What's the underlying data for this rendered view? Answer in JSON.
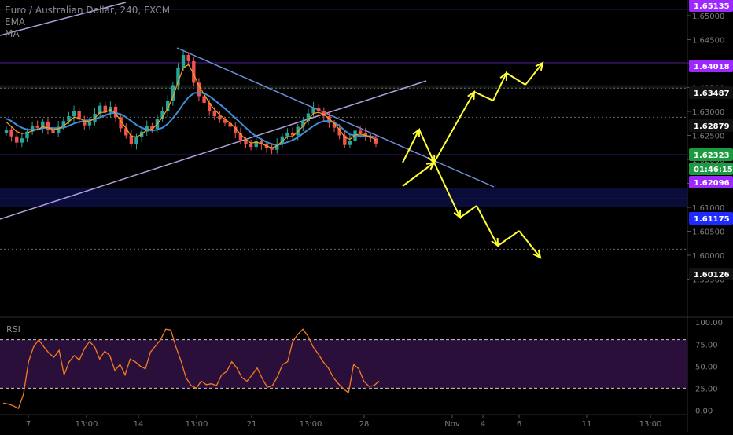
{
  "symbol_title": "Euro / Australian Dollar, 240, FXCM",
  "indicators": [
    "EMA",
    "MA"
  ],
  "colors": {
    "background": "#000000",
    "up_candle": "#26a69a",
    "down_candle": "#ef5350",
    "ema": "#f7a21b",
    "ma": "#3e8fd8",
    "trendline_down": "#6d8fdb",
    "channel_line": "#b39ddb",
    "projection_arrow": "#ffff33",
    "rsi_line": "#f57c21",
    "rsi_band": "#2a0f3a",
    "level_purple": "#9c27ff",
    "level_blue": "#1e2bff",
    "current_price": "#1b9a3f"
  },
  "chart_data": [
    {
      "type": "candlestick",
      "name": "price",
      "ylim": [
        1.5925,
        1.6535
      ],
      "y_ticks": [
        "1.65000",
        "1.64500",
        "1.64000",
        "1.63500",
        "1.63000",
        "1.62500",
        "1.62000",
        "1.61500",
        "1.61000",
        "1.60500",
        "1.60000",
        "1.59500"
      ],
      "x_ticks": [
        "7",
        "13:00",
        "14",
        "13:00",
        "21",
        "13:00",
        "28",
        "Nov",
        "4",
        "6",
        "11",
        "13:00"
      ],
      "price_labels": [
        {
          "text": "1.65135",
          "style": "purple"
        },
        {
          "text": "1.64018",
          "style": "purple"
        },
        {
          "text": "1.63487",
          "style": "dark"
        },
        {
          "text": "1.62879",
          "style": "dark"
        },
        {
          "text": "1.62323",
          "style": "green"
        },
        {
          "text": "01:46:15",
          "style": "green"
        },
        {
          "text": "1.62096",
          "style": "purple"
        },
        {
          "text": "1.61175",
          "style": "blue"
        },
        {
          "text": "1.60126",
          "style": "dark"
        }
      ],
      "horizontal_levels": [
        1.65135,
        1.64018,
        1.63487,
        1.62879,
        1.62096,
        1.61175,
        1.60126
      ],
      "close_series_start": 1.6255,
      "close_series": [
        1.6262,
        1.6248,
        1.6235,
        1.6244,
        1.6258,
        1.627,
        1.6266,
        1.6279,
        1.6262,
        1.6255,
        1.6268,
        1.628,
        1.629,
        1.6301,
        1.6283,
        1.6271,
        1.6278,
        1.6295,
        1.6312,
        1.6298,
        1.631,
        1.6288,
        1.6265,
        1.625,
        1.6232,
        1.6246,
        1.6258,
        1.627,
        1.6264,
        1.6285,
        1.63,
        1.6322,
        1.6355,
        1.6392,
        1.6418,
        1.6405,
        1.636,
        1.6332,
        1.6318,
        1.63,
        1.629,
        1.6283,
        1.6276,
        1.6268,
        1.6254,
        1.624,
        1.6232,
        1.6226,
        1.6238,
        1.6231,
        1.6224,
        1.622,
        1.6232,
        1.6248,
        1.6256,
        1.625,
        1.6268,
        1.628,
        1.6296,
        1.6308,
        1.63,
        1.629,
        1.6276,
        1.6266,
        1.625,
        1.623,
        1.6238,
        1.626,
        1.6255,
        1.6248,
        1.6244,
        1.6233
      ],
      "ema_series": [
        1.6278,
        1.6268,
        1.6258,
        1.6254,
        1.6255,
        1.626,
        1.6262,
        1.6268,
        1.6266,
        1.6262,
        1.6264,
        1.627,
        1.6278,
        1.6288,
        1.6286,
        1.628,
        1.6279,
        1.6286,
        1.6298,
        1.6298,
        1.6304,
        1.6296,
        1.628,
        1.6265,
        1.6248,
        1.6247,
        1.6252,
        1.6262,
        1.6263,
        1.6274,
        1.6288,
        1.6306,
        1.633,
        1.6362,
        1.6391,
        1.6398,
        1.6378,
        1.6354,
        1.6336,
        1.6318,
        1.6304,
        1.6293,
        1.6284,
        1.6276,
        1.6265,
        1.6252,
        1.6242,
        1.6234,
        1.6236,
        1.6233,
        1.6228,
        1.6224,
        1.6228,
        1.6238,
        1.6247,
        1.6248,
        1.6258,
        1.6269,
        1.6283,
        1.6296,
        1.6298,
        1.6294,
        1.6285,
        1.6275,
        1.6262,
        1.6246,
        1.6242,
        1.6251,
        1.6253,
        1.625,
        1.6247,
        1.624
      ],
      "ma_series": [
        1.6285,
        1.628,
        1.6272,
        1.6266,
        1.6262,
        1.6262,
        1.6263,
        1.6265,
        1.6266,
        1.6265,
        1.6265,
        1.6266,
        1.627,
        1.6275,
        1.6278,
        1.628,
        1.6282,
        1.6284,
        1.6288,
        1.6292,
        1.6296,
        1.6297,
        1.6294,
        1.6288,
        1.628,
        1.6272,
        1.6266,
        1.6262,
        1.626,
        1.6262,
        1.6266,
        1.6274,
        1.6286,
        1.63,
        1.6316,
        1.633,
        1.6338,
        1.634,
        1.6338,
        1.6332,
        1.6324,
        1.6315,
        1.6306,
        1.6296,
        1.6286,
        1.6276,
        1.6266,
        1.6256,
        1.6248,
        1.6242,
        1.6236,
        1.6232,
        1.623,
        1.6232,
        1.6236,
        1.624,
        1.6246,
        1.6254,
        1.6262,
        1.627,
        1.6276,
        1.628,
        1.628,
        1.6277,
        1.627,
        1.626,
        1.6252,
        1.625,
        1.6249,
        1.6249,
        1.6248,
        1.6246
      ]
    },
    {
      "type": "line",
      "name": "RSI",
      "label": "RSI",
      "ylim": [
        -5,
        102
      ],
      "y_ticks": [
        "100.00",
        "75.00",
        "50.00",
        "25.00",
        "0.00"
      ],
      "bands": [
        25,
        80
      ],
      "values": [
        8,
        7,
        5,
        2,
        18,
        55,
        72,
        80,
        72,
        65,
        60,
        68,
        40,
        55,
        62,
        57,
        70,
        78,
        72,
        58,
        67,
        62,
        45,
        52,
        40,
        58,
        55,
        50,
        47,
        66,
        73,
        80,
        92,
        91,
        72,
        56,
        37,
        28,
        25,
        33,
        29,
        30,
        28,
        40,
        44,
        55,
        48,
        37,
        33,
        40,
        48,
        36,
        26,
        28,
        38,
        52,
        55,
        78,
        86,
        92,
        84,
        72,
        64,
        55,
        48,
        37,
        30,
        24,
        20,
        52,
        47,
        33,
        27,
        28,
        33
      ]
    }
  ]
}
